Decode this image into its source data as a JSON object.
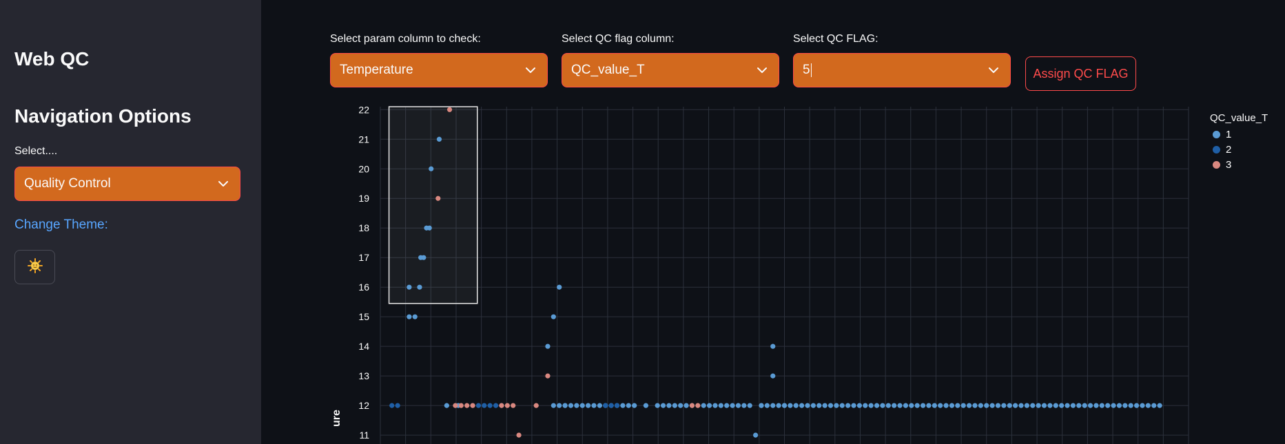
{
  "sidebar": {
    "app_title": "Web QC",
    "nav_title": "Navigation Options",
    "select_label": "Select....",
    "select_value": "Quality Control",
    "change_theme_label": "Change Theme:",
    "theme_icon": "sun-face-icon"
  },
  "controls": {
    "param_label": "Select param column to check:",
    "param_value": "Temperature",
    "flag_col_label": "Select QC flag column:",
    "flag_col_value": "QC_value_T",
    "qc_flag_label": "Select QC FLAG:",
    "qc_flag_value": "5",
    "assign_button": "Assign QC FLAG"
  },
  "colors": {
    "accent_select": "#d2691e",
    "accent_border": "#ff4b4b",
    "series_1": "#5a9bd4",
    "series_2": "#1f5fa6",
    "series_3": "#d98880"
  },
  "chart_data": {
    "type": "scatter",
    "ylabel": "ure",
    "legend_title": "QC_value_T",
    "legend_placement": "top-right",
    "grid": true,
    "ylim": [
      10.7,
      22.1
    ],
    "xlim": [
      0,
      140
    ],
    "yticks": [
      11,
      12,
      13,
      14,
      15,
      16,
      17,
      18,
      19,
      20,
      21,
      22
    ],
    "selection_box": {
      "x0": 1.5,
      "x1": 16.8,
      "y0": 15.45,
      "y1": 22.1
    },
    "series": [
      {
        "name": "1",
        "color": "#5a9bd4",
        "x": [
          5,
          5,
          7.5,
          8,
          6,
          6.8,
          7,
          8.5,
          8.8,
          10.2,
          11.5,
          13.5,
          29,
          30,
          31,
          32,
          33,
          65,
          66,
          68,
          68,
          70,
          30,
          31,
          32,
          34,
          35,
          36,
          37,
          38,
          39,
          40,
          41,
          42,
          43,
          44,
          46,
          48,
          49,
          50,
          51,
          52,
          53,
          54,
          56,
          57,
          58,
          59,
          60,
          61,
          62,
          63,
          64,
          66,
          67,
          68,
          69,
          70,
          71,
          72,
          73,
          74,
          75,
          76,
          77,
          78,
          79,
          80,
          81,
          82,
          83,
          84,
          85,
          86,
          87,
          88,
          89,
          90,
          91,
          92,
          93,
          94,
          95,
          96,
          97,
          98,
          99,
          100,
          101,
          102,
          103,
          104,
          105,
          106,
          107,
          108,
          109,
          110,
          111,
          112,
          113,
          114,
          115,
          116,
          117,
          118,
          119,
          120,
          121,
          122,
          123,
          124,
          125,
          126,
          127,
          128,
          129,
          130,
          131,
          132,
          133,
          134,
          135
        ],
        "y": [
          15,
          16,
          17,
          18,
          15,
          16,
          17,
          18,
          20,
          21,
          12,
          12,
          14,
          15,
          16,
          12,
          12,
          11,
          12,
          13,
          14,
          12,
          12,
          12,
          12,
          12,
          12,
          12,
          12,
          12,
          12,
          12,
          12,
          12,
          12,
          12,
          12,
          12,
          12,
          12,
          12,
          12,
          12,
          12,
          12,
          12,
          12,
          12,
          12,
          12,
          12,
          12,
          12,
          12,
          12,
          12,
          12,
          12,
          12,
          12,
          12,
          12,
          12,
          12,
          12,
          12,
          12,
          12,
          12,
          12,
          12,
          12,
          12,
          12,
          12,
          12,
          12,
          12,
          12,
          12,
          12,
          12,
          12,
          12,
          12,
          12,
          12,
          12,
          12,
          12,
          12,
          12,
          12,
          12,
          12,
          12,
          12,
          12,
          12,
          12,
          12,
          12,
          12,
          12,
          12,
          12,
          12,
          12,
          12,
          12,
          12,
          12,
          12,
          12,
          12,
          12,
          12,
          12,
          12,
          12,
          12,
          12,
          12
        ]
      },
      {
        "name": "2",
        "color": "#1f5fa6",
        "x": [
          2,
          3,
          16,
          17,
          18,
          19,
          20,
          21,
          39,
          40,
          41
        ],
        "y": [
          12,
          12,
          12,
          12,
          12,
          12,
          12,
          12,
          12,
          12,
          12
        ]
      },
      {
        "name": "3",
        "color": "#d98880",
        "x": [
          12,
          10,
          14,
          13,
          15,
          16,
          21,
          22,
          23,
          24,
          27,
          29,
          54,
          55
        ],
        "y": [
          22,
          19,
          12,
          12,
          12,
          12,
          12,
          12,
          12,
          11,
          12,
          13,
          12,
          12
        ]
      }
    ]
  }
}
